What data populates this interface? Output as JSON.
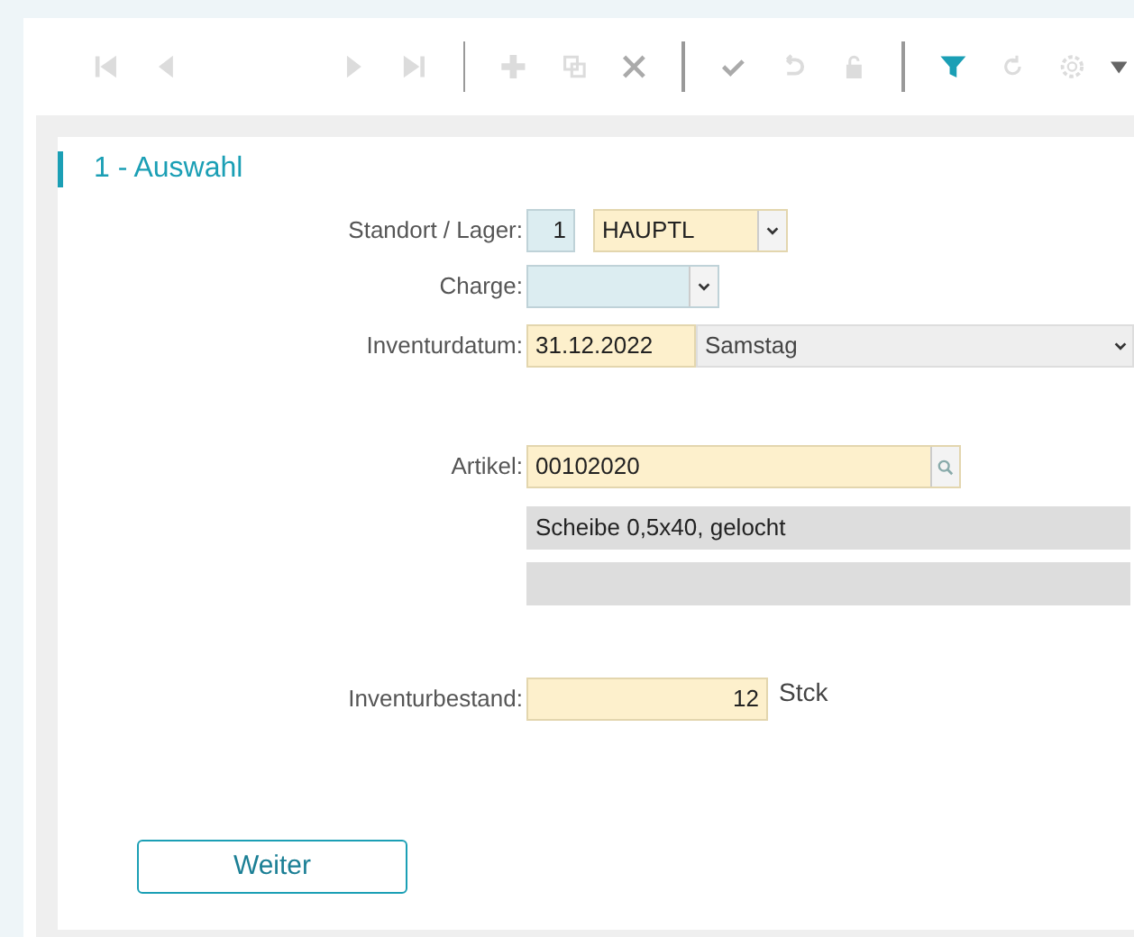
{
  "toolbar": [
    {
      "kind": "first",
      "disabled": true
    },
    {
      "kind": "prev",
      "disabled": true
    },
    {
      "kind": "next",
      "disabled": true
    },
    {
      "kind": "last",
      "disabled": true
    },
    {
      "kind": "separator"
    },
    {
      "kind": "add",
      "disabled": true
    },
    {
      "kind": "copy",
      "disabled": true
    },
    {
      "kind": "delete",
      "disabled": false
    },
    {
      "kind": "separator"
    },
    {
      "kind": "save",
      "disabled": false
    },
    {
      "kind": "undo",
      "disabled": true
    },
    {
      "kind": "lock",
      "disabled": true
    },
    {
      "kind": "separator"
    },
    {
      "kind": "filter",
      "disabled": false
    },
    {
      "kind": "refresh",
      "disabled": true
    },
    {
      "kind": "settings",
      "disabled": true
    },
    {
      "kind": "menu",
      "disabled": false
    }
  ],
  "section": {
    "title": "1 - Auswahl"
  },
  "rows": [
    {
      "label": "Standort / Lager:",
      "controls": [
        {
          "kind": "number",
          "required": false,
          "readonly": false,
          "value": "1"
        },
        {
          "kind": "select",
          "required": true,
          "readonly": false,
          "value": "HAUPTL"
        }
      ]
    },
    {
      "label": "Charge:",
      "controls": [
        {
          "kind": "select",
          "required": false,
          "readonly": false
        }
      ]
    },
    {
      "label": "Inventurdatum:",
      "controls": [
        {
          "kind": "input",
          "required": true,
          "readonly": false,
          "value": "31.12.2022"
        },
        {
          "kind": "select",
          "readonly": true,
          "value": "Samstag"
        }
      ]
    },
    {
      "kind": "gap"
    },
    {
      "label": "Artikel:",
      "controls": [
        {
          "kind": "lookup",
          "required": true,
          "readonly": false,
          "value": "00102020"
        }
      ]
    },
    {
      "controls": [
        {
          "kind": "input",
          "readonly": true,
          "value": "Scheibe 0,5x40, gelocht"
        }
      ]
    },
    {
      "controls": [
        {
          "kind": "input",
          "readonly": true
        }
      ]
    },
    {
      "kind": "gap"
    },
    {
      "label": "Inventurbestand:",
      "controls": [
        {
          "kind": "number",
          "required": true,
          "readonly": false,
          "value": "12"
        },
        {
          "kind": "unit",
          "value": "Stck"
        }
      ]
    }
  ],
  "buttons": [
    {
      "label": "Weiter"
    }
  ]
}
